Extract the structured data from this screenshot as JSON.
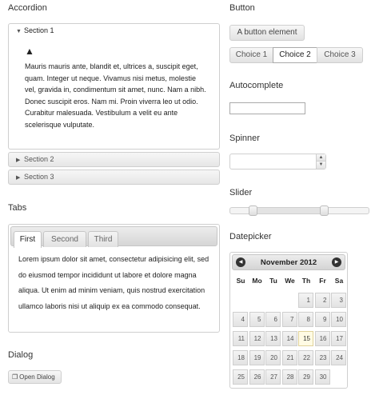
{
  "accordion": {
    "heading": "Accordion",
    "sections": [
      {
        "label": "Section 1",
        "open": true
      },
      {
        "label": "Section 2",
        "open": false
      },
      {
        "label": "Section 3",
        "open": false
      }
    ],
    "content": "Mauris mauris ante, blandit et, ultrices a, suscipit eget, quam. Integer ut neque. Vivamus nisi metus, molestie vel, gravida in, condimentum sit amet, nunc. Nam a nibh. Donec suscipit eros. Nam mi. Proin viverra leo ut odio. Curabitur malesuada. Vestibulum a velit eu ante scelerisque vulputate."
  },
  "tabs": {
    "heading": "Tabs",
    "items": [
      "First",
      "Second",
      "Third"
    ],
    "active_index": 0,
    "content": "Lorem ipsum dolor sit amet, consectetur adipisicing elit, sed do eiusmod tempor incididunt ut labore et dolore magna aliqua. Ut enim ad minim veniam, quis nostrud exercitation ullamco laboris nisi ut aliquip ex ea commodo consequat."
  },
  "dialog": {
    "heading": "Dialog",
    "button_label": "Open Dialog"
  },
  "button": {
    "heading": "Button",
    "element_label": "A button element",
    "choices": [
      "Choice 1",
      "Choice 2",
      "Choice 3"
    ],
    "selected_index": 1
  },
  "autocomplete": {
    "heading": "Autocomplete",
    "value": ""
  },
  "spinner": {
    "heading": "Spinner",
    "value": ""
  },
  "slider": {
    "heading": "Slider",
    "range_min_fraction": 0.17,
    "range_max_fraction": 0.68
  },
  "datepicker": {
    "heading": "Datepicker",
    "month_label": "November 2012",
    "weekdays": [
      "Su",
      "Mo",
      "Tu",
      "We",
      "Th",
      "Fr",
      "Sa"
    ],
    "first_weekday_index": 4,
    "days_in_month": 30,
    "today": 15
  },
  "icons": {
    "accordion_active": "triangle-down-icon",
    "accordion_inactive": "triangle-right-icon",
    "warning": "warning-icon",
    "dialog": "new-window-icon",
    "prev": "circle-arrow-left-icon",
    "next": "circle-arrow-right-icon",
    "spin_up": "triangle-up-icon",
    "spin_down": "triangle-down-icon"
  }
}
